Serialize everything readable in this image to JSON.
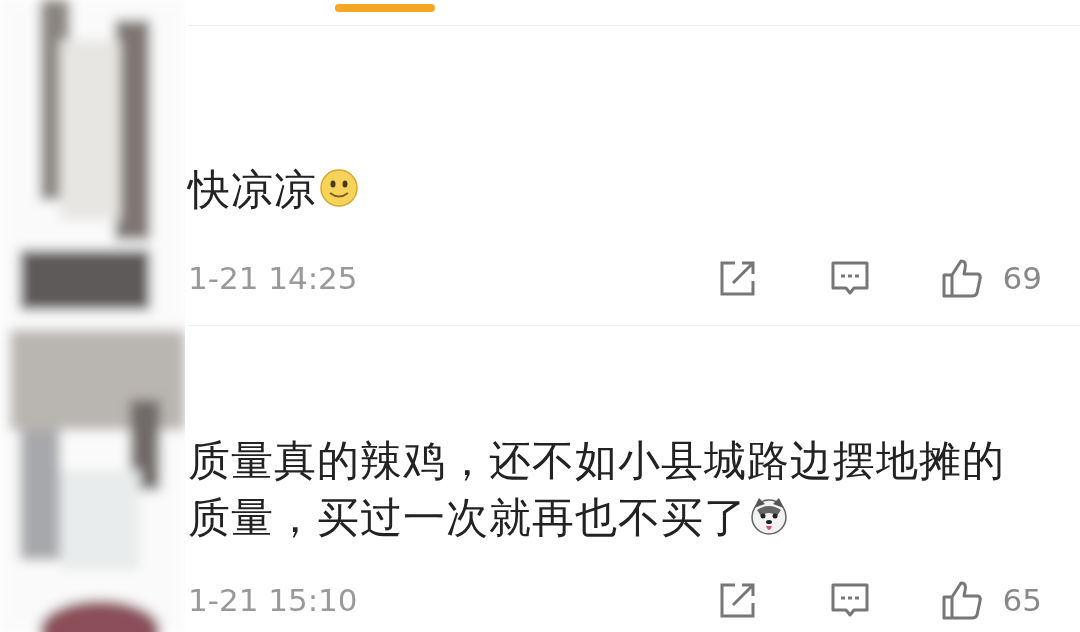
{
  "comments": [
    {
      "text": "快凉凉",
      "kind": "smile",
      "time": "1-21 14:25",
      "like_count": "69"
    },
    {
      "text": "质量真的辣鸡，还不如小县城路边摆地摊的质量，买过一次就再也不买了",
      "kind": "dog",
      "time": "1-21 15:10",
      "like_count": "65"
    }
  ]
}
